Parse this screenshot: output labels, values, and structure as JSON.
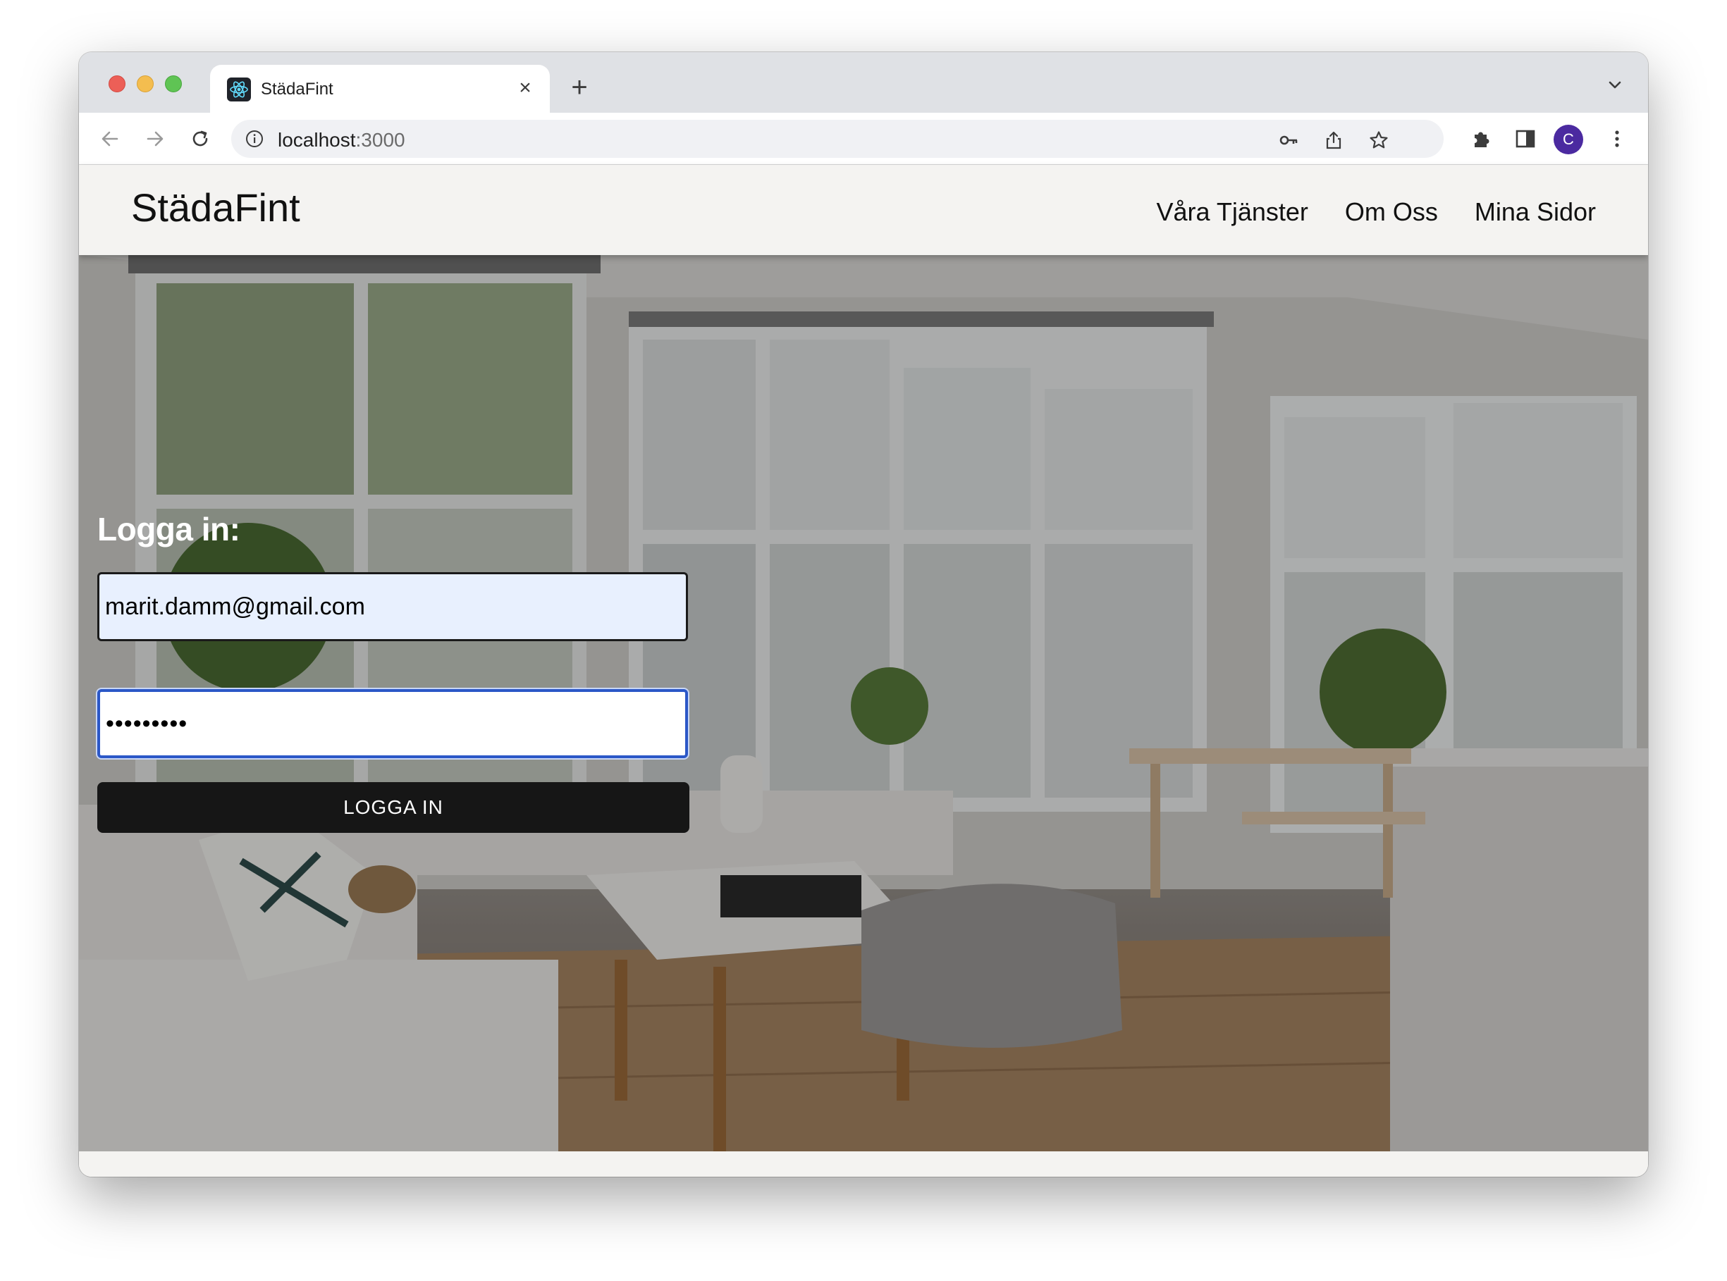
{
  "browser": {
    "tab_title": "StädaFint",
    "close_symbol": "×",
    "new_tab_symbol": "+",
    "url_host": "localhost",
    "url_port": ":3000",
    "profile_initial": "C"
  },
  "site": {
    "brand": "StädaFint",
    "nav": [
      "Våra Tjänster",
      "Om Oss",
      "Mina Sidor"
    ]
  },
  "login": {
    "heading": "Logga in:",
    "email_value": "marit.damm@gmail.com",
    "password_value": "•••••••••",
    "button_label": "LOGGA IN"
  },
  "colors": {
    "accent_focus": "#2b57c7",
    "autofill_bg": "#e8f0fe",
    "button_bg": "#161616",
    "avatar_bg": "#4b2aa0"
  },
  "icons": [
    "back-icon",
    "forward-icon",
    "reload-icon",
    "info-icon",
    "key-icon",
    "share-icon",
    "star-icon",
    "extensions-icon",
    "sidepanel-icon",
    "more-icon",
    "chevron-down-icon",
    "react-favicon"
  ]
}
